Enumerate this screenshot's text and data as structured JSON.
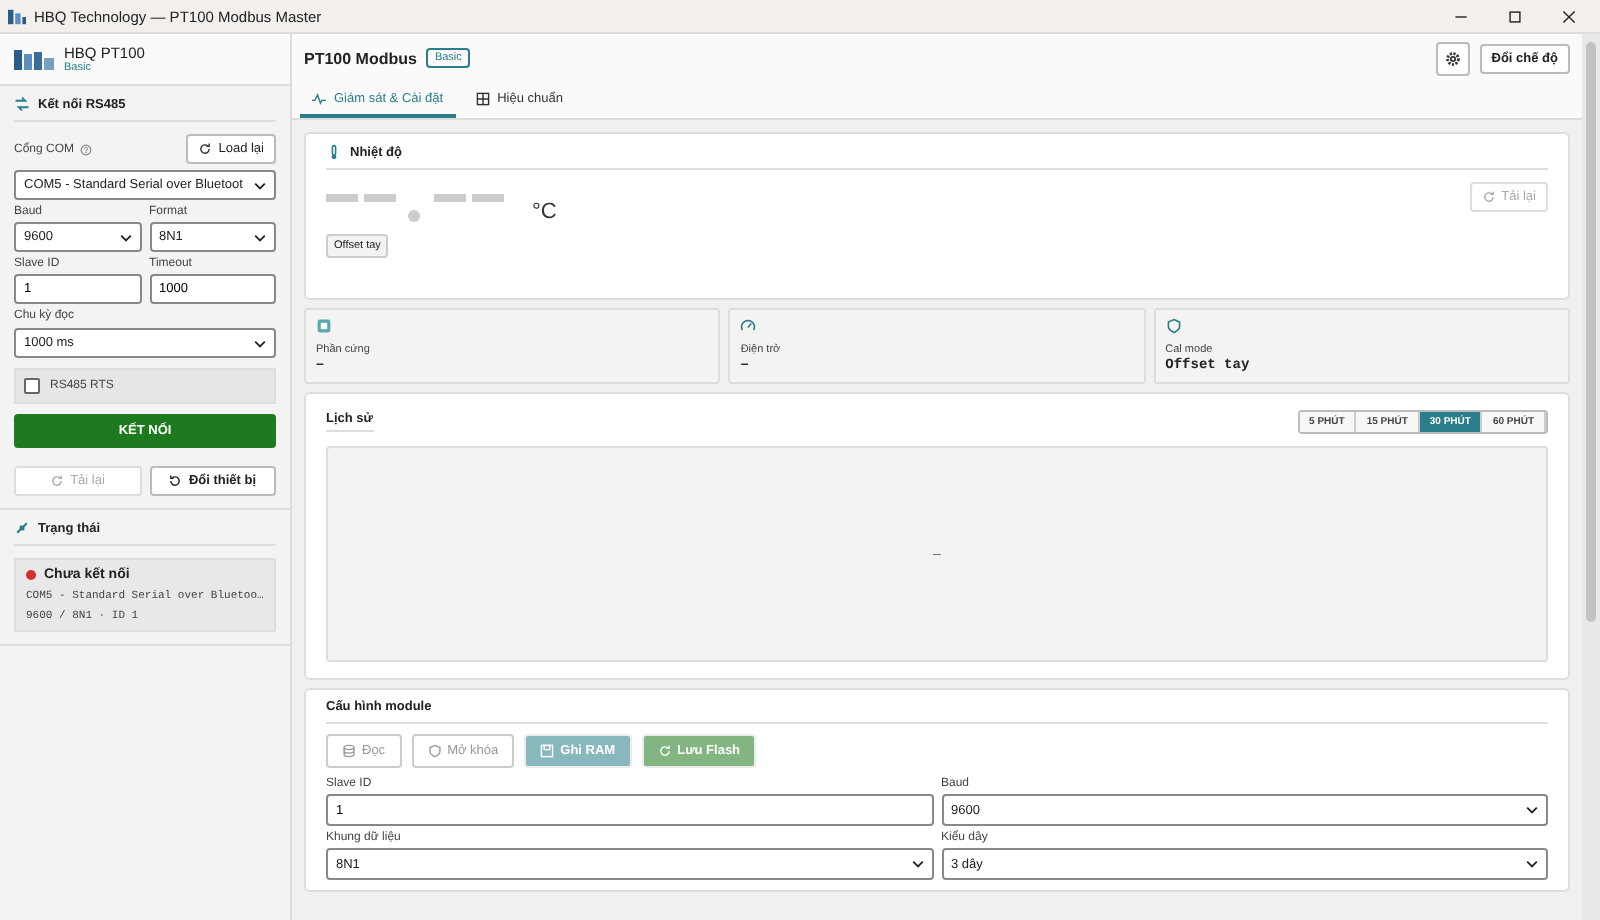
{
  "window": {
    "title": "HBQ Technology — PT100 Modbus Master"
  },
  "sidebar": {
    "brand": {
      "name": "HBQ PT100",
      "edition": "Basic"
    },
    "connection": {
      "title": "Kết nối RS485",
      "com_label": "Cổng COM",
      "load_button": "Load lại",
      "com_value": "COM5 - Standard Serial over Bluetoot",
      "baud_label": "Baud",
      "baud_value": "9600",
      "format_label": "Format",
      "format_value": "8N1",
      "slave_label": "Slave ID",
      "slave_value": "1",
      "timeout_label": "Timeout",
      "timeout_value": "1000",
      "cycle_label": "Chu kỳ đọc",
      "cycle_value": "1000 ms",
      "rts": {
        "label": "RS485 RTS",
        "checked": false
      },
      "connect_button": "KẾT NỐI",
      "reload_button": {
        "label": "Tải lại",
        "disabled": true
      },
      "change_button": {
        "label": "Đổi thiết bị",
        "disabled": false
      }
    },
    "status": {
      "title": "Trạng thái",
      "state": "Chưa kết nối",
      "color": "#d32f2f",
      "port": "COM5 - Standard Serial over Bluetoo…",
      "params": "9600 / 8N1 · ID 1"
    }
  },
  "header": {
    "title": "PT100 Modbus",
    "badge": "Basic",
    "mode_button": "Đổi chế độ"
  },
  "tabs": [
    {
      "label": "Giám sát & Cài đặt",
      "selected": true,
      "kind": "pulse"
    },
    {
      "label": "Hiệu chuẩn",
      "selected": false,
      "kind": "grid"
    }
  ],
  "temperature": {
    "title": "Nhiệt độ",
    "unit": "°C",
    "tag": "Offset tay",
    "reload_button": {
      "label": "Tải lại",
      "disabled": true
    }
  },
  "info_cards": [
    {
      "kind": "chip",
      "label": "Phần cứng",
      "value": "–"
    },
    {
      "kind": "gauge",
      "label": "Điện trở",
      "value": "–"
    },
    {
      "kind": "shield",
      "label": "Cal mode",
      "value": "Offset tay"
    }
  ],
  "history": {
    "title": "Lịch sử",
    "ranges": [
      {
        "label": "5 PHÚT",
        "selected": false
      },
      {
        "label": "15 PHÚT",
        "selected": false
      },
      {
        "label": "30 PHÚT",
        "selected": true
      },
      {
        "label": "60 PHÚT",
        "selected": false
      }
    ],
    "empty": "–"
  },
  "config": {
    "title": "Cấu hình module",
    "buttons": [
      {
        "label": "Đọc",
        "kind": "read",
        "disabled": true
      },
      {
        "label": "Mở khóa",
        "kind": "unlock",
        "disabled": true
      },
      {
        "label": "Ghi RAM",
        "kind": "write",
        "disabled": true
      },
      {
        "label": "Lưu Flash",
        "kind": "save",
        "disabled": true
      }
    ],
    "fields": [
      {
        "label": "Slave ID",
        "kind": "input",
        "value": "1"
      },
      {
        "label": "Baud",
        "kind": "select",
        "value": "9600"
      },
      {
        "label": "Khung dữ liệu",
        "kind": "select",
        "value": "8N1"
      },
      {
        "label": "Kiểu dây",
        "kind": "select",
        "value": "3 dây"
      }
    ]
  }
}
